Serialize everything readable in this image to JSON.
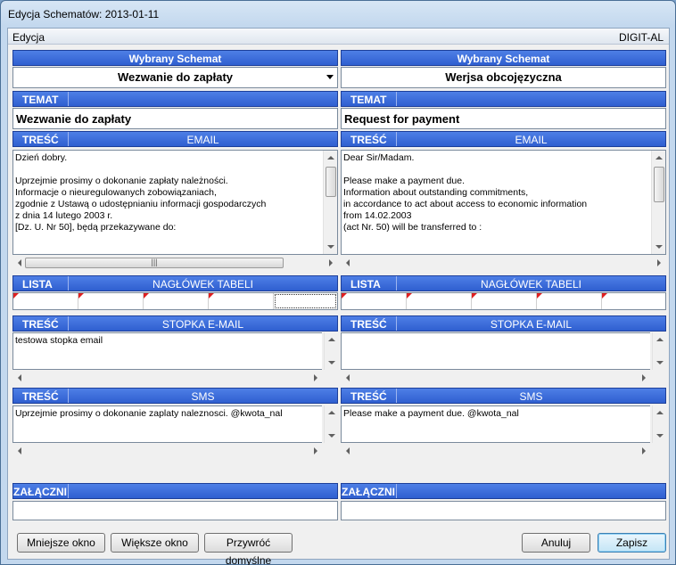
{
  "window": {
    "title": "Edycja Schematów: 2013-01-11"
  },
  "menu": {
    "edit": "Edycja",
    "company": "DIGIT-AL"
  },
  "left": {
    "schema_header": "Wybrany Schemat",
    "schema_value": "Wezwanie do zapłaty",
    "subject_label": "TEMAT",
    "subject_value": "Wezwanie do zapłaty",
    "content_label": "TREŚĆ",
    "email_label": "EMAIL",
    "email_body": "Dzień dobry.\n\nUprzejmie prosimy o dokonanie zapłaty należności.\nInformacje o nieuregulowanych zobowiązaniach,\nzgodnie z Ustawą o udostępnianiu informacji gospodarczych\nz dnia 14 lutego 2003 r.\n[Dz. U. Nr 50], będą przekazywane do:",
    "list_label": "LISTA",
    "table_header_label": "NAGŁÓWEK TABELI",
    "footer_content_label": "TREŚĆ",
    "footer_label": "STOPKA E-MAIL",
    "footer_body": "testowa stopka email",
    "sms_content_label": "TREŚĆ",
    "sms_label": "SMS",
    "sms_body": "Uprzejmie prosimy o dokonanie zaplaty naleznosci. @kwota_nal",
    "attachments_label": "ZAŁĄCZNI"
  },
  "right": {
    "schema_header": "Wybrany Schemat",
    "schema_value": "Werjsa obcojęzyczna",
    "subject_label": "TEMAT",
    "subject_value": "Request for payment",
    "content_label": "TREŚĆ",
    "email_label": "EMAIL",
    "email_body": "Dear Sir/Madam.\n\nPlease make a payment due.\nInformation about outstanding commitments,\nin accordance to act about access to economic information\nfrom 14.02.2003\n(act Nr. 50) will be transferred to :",
    "list_label": "LISTA",
    "table_header_label": "NAGŁÓWEK TABELI",
    "footer_content_label": "TREŚĆ",
    "footer_label": "STOPKA E-MAIL",
    "footer_body": "",
    "sms_content_label": "TREŚĆ",
    "sms_label": "SMS",
    "sms_body": "Please make a payment due. @kwota_nal",
    "attachments_label": "ZAŁĄCZNI"
  },
  "buttons": {
    "smaller": "Mniejsze okno",
    "larger": "Większe okno",
    "restore": "Przywróć domyślne",
    "cancel": "Anuluj",
    "save": "Zapisz"
  },
  "colors": {
    "header_blue": "#3a6be0",
    "grid_marker": "#e02020"
  },
  "icons": {
    "combo": "chevron-down-icon"
  }
}
